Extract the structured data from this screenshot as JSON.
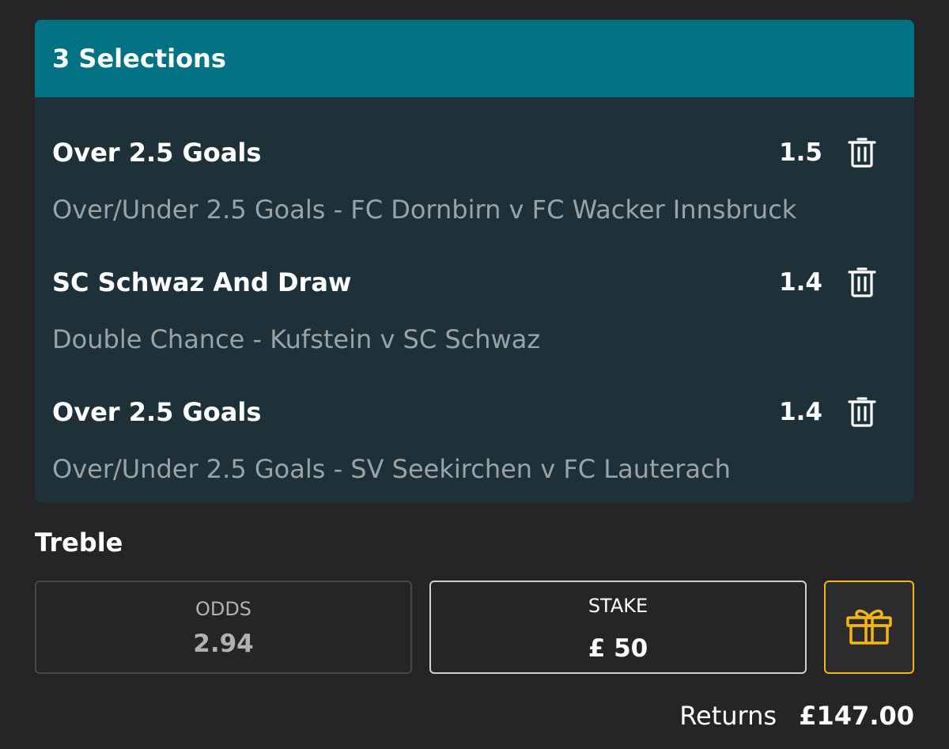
{
  "header": {
    "title": "3 Selections"
  },
  "selections": [
    {
      "name": "Over 2.5 Goals",
      "odds": "1.5",
      "market": "Over/Under 2.5 Goals - FC Dornbirn v FC Wacker Innsbruck"
    },
    {
      "name": "SC Schwaz And Draw",
      "odds": "1.4",
      "market": "Double Chance - Kufstein v SC Schwaz"
    },
    {
      "name": "Over 2.5 Goals",
      "odds": "1.4",
      "market": "Over/Under 2.5 Goals - SV Seekirchen v FC Lauterach"
    }
  ],
  "bet": {
    "type": "Treble",
    "odds_label": "ODDS",
    "odds_value": "2.94",
    "stake_label": "STAKE",
    "stake_value": "£ 50",
    "gift_icon": "gift-icon",
    "returns_label": "Returns",
    "returns_value": "£147.00"
  },
  "colors": {
    "background": "#252527",
    "header": "#007284",
    "card": "#1e3038",
    "accent": "#f5b512"
  }
}
